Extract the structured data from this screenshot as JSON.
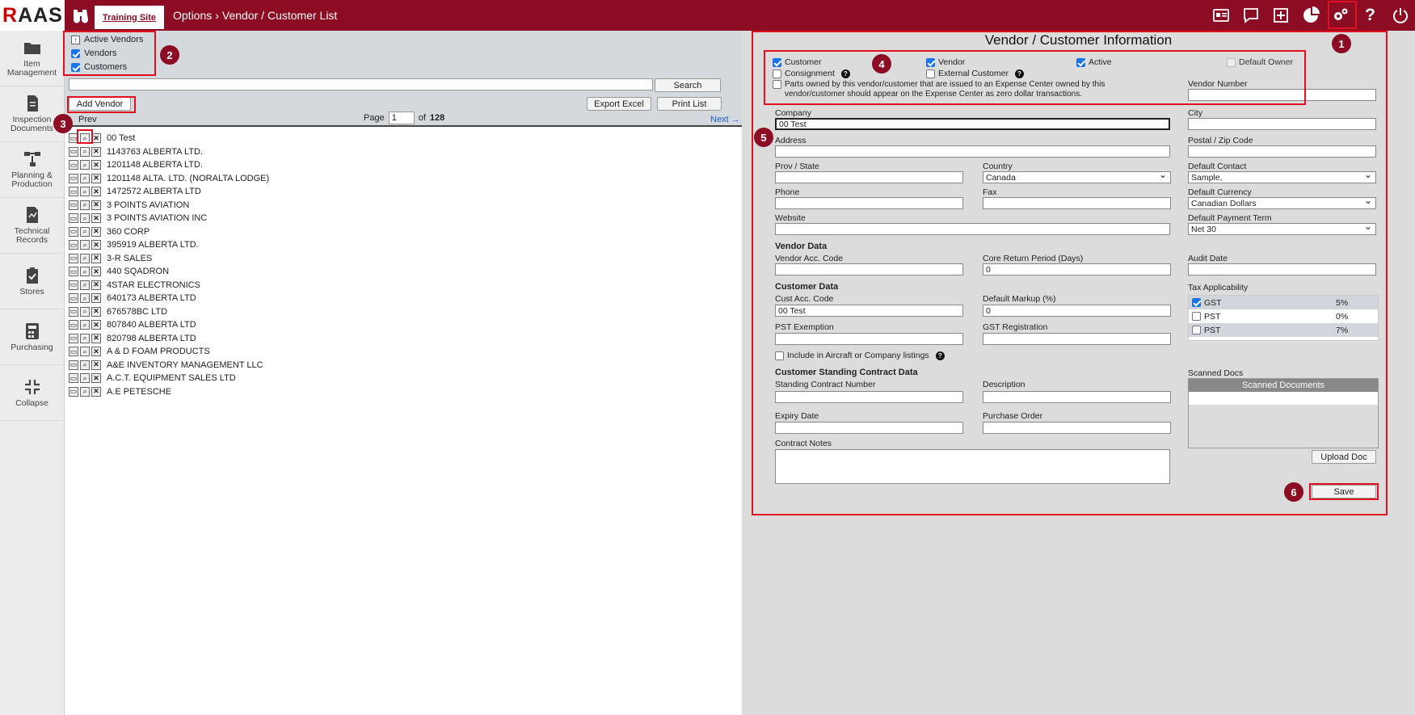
{
  "app": {
    "logo": "RAAS",
    "site_tab": "Training Site",
    "breadcrumb": [
      "Options",
      "Vendor / Customer List"
    ],
    "accent": "#8b0c23"
  },
  "top_icons": [
    "id-card-icon",
    "chat-icon",
    "plus-box-icon",
    "pie-chart-icon",
    "gears-icon",
    "help-icon",
    "power-icon"
  ],
  "leftnav": [
    {
      "label": "Item Management",
      "icon": "folder-icon"
    },
    {
      "label": "Inspection Documents",
      "icon": "document-icon"
    },
    {
      "label": "Planning & Production",
      "icon": "flow-icon"
    },
    {
      "label": "Technical Records",
      "icon": "records-icon"
    },
    {
      "label": "Stores",
      "icon": "clipboard-check-icon"
    },
    {
      "label": "Purchasing",
      "icon": "calculator-icon"
    },
    {
      "label": "Collapse",
      "icon": "collapse-icon"
    }
  ],
  "filters": {
    "active_vendors": "Active Vendors",
    "vendors": "Vendors",
    "customers": "Customers"
  },
  "list": {
    "search_value": "",
    "search_label": "Search",
    "add_vendor": "Add Vendor",
    "export_excel": "Export Excel",
    "print_list": "Print List",
    "prev": "Prev",
    "next": "Next →",
    "page_label": "Page",
    "page_value": "1",
    "of_label": "of",
    "total_pages": "128",
    "rows": [
      "00 Test",
      "1143763 ALBERTA LTD.",
      "1201148 ALBERTA LTD.",
      "1201148 ALTA. LTD. (NORALTA LODGE)",
      "1472572 ALBERTA LTD",
      "3 POINTS AVIATION",
      "3 POINTS AVIATION INC",
      "360 CORP",
      "395919 ALBERTA LTD.",
      "3-R SALES",
      "440 SQADRON",
      "4STAR ELECTRONICS",
      "640173 ALBERTA LTD",
      "676578BC LTD",
      "807840 ALBERTA LTD",
      "820798 ALBERTA LTD",
      "A & D FOAM PRODUCTS",
      "A&E INVENTORY MANAGEMENT LLC",
      "A.C.T. EQUIPMENT SALES LTD",
      "A.E PETESCHE"
    ]
  },
  "info": {
    "title": "Vendor / Customer Information",
    "customer": "Customer",
    "vendor": "Vendor",
    "active": "Active",
    "default_owner": "Default Owner",
    "consignment": "Consignment",
    "external_customer": "External Customer",
    "parts_owned": "Parts owned by this vendor/customer that are issued to an Expense Center owned by this vendor/customer should appear on the Expense Center as zero dollar transactions.",
    "vendor_number_label": "Vendor Number",
    "vendor_number": "",
    "company_label": "Company",
    "company": "00 Test",
    "city_label": "City",
    "city": "",
    "address_label": "Address",
    "address": "",
    "postal_label": "Postal / Zip Code",
    "postal": "",
    "prov_label": "Prov / State",
    "prov": "",
    "country_label": "Country",
    "country": "Canada",
    "default_contact_label": "Default Contact",
    "default_contact": "Sample,",
    "phone_label": "Phone",
    "phone": "",
    "fax_label": "Fax",
    "fax": "",
    "default_currency_label": "Default Currency",
    "default_currency": "Canadian Dollars",
    "website_label": "Website",
    "website": "",
    "default_payment_label": "Default Payment Term",
    "default_payment": "Net 30",
    "vendor_data": "Vendor Data",
    "vendor_acc_label": "Vendor Acc. Code",
    "vendor_acc": "",
    "core_return_label": "Core Return Period (Days)",
    "core_return": "0",
    "audit_date_label": "Audit Date",
    "audit_date": "",
    "customer_data": "Customer Data",
    "cust_acc_label": "Cust Acc. Code",
    "cust_acc": "00 Test",
    "default_markup_label": "Default Markup (%)",
    "default_markup": "0",
    "tax_label": "Tax Applicability",
    "taxes": [
      {
        "name": "GST",
        "rate": "5%",
        "checked": true
      },
      {
        "name": "PST",
        "rate": "0%",
        "checked": false
      },
      {
        "name": "PST",
        "rate": "7%",
        "checked": false
      }
    ],
    "pst_exemption_label": "PST Exemption",
    "pst_exemption": "",
    "gst_registration_label": "GST Registration",
    "gst_registration": "",
    "include_listings": "Include in Aircraft or Company listings",
    "standing_contract": "Customer Standing Contract Data",
    "scanned_docs_label": "Scanned Docs",
    "scanned_docs_head": "Scanned Documents",
    "standing_number_label": "Standing Contract Number",
    "standing_number": "",
    "description_label": "Description",
    "description": "",
    "expiry_label": "Expiry Date",
    "expiry": "",
    "purchase_order_label": "Purchase Order",
    "purchase_order": "",
    "upload_doc": "Upload Doc",
    "contract_notes_label": "Contract Notes",
    "contract_notes": "",
    "save": "Save"
  },
  "badges": [
    "1",
    "2",
    "3",
    "4",
    "5",
    "6"
  ]
}
